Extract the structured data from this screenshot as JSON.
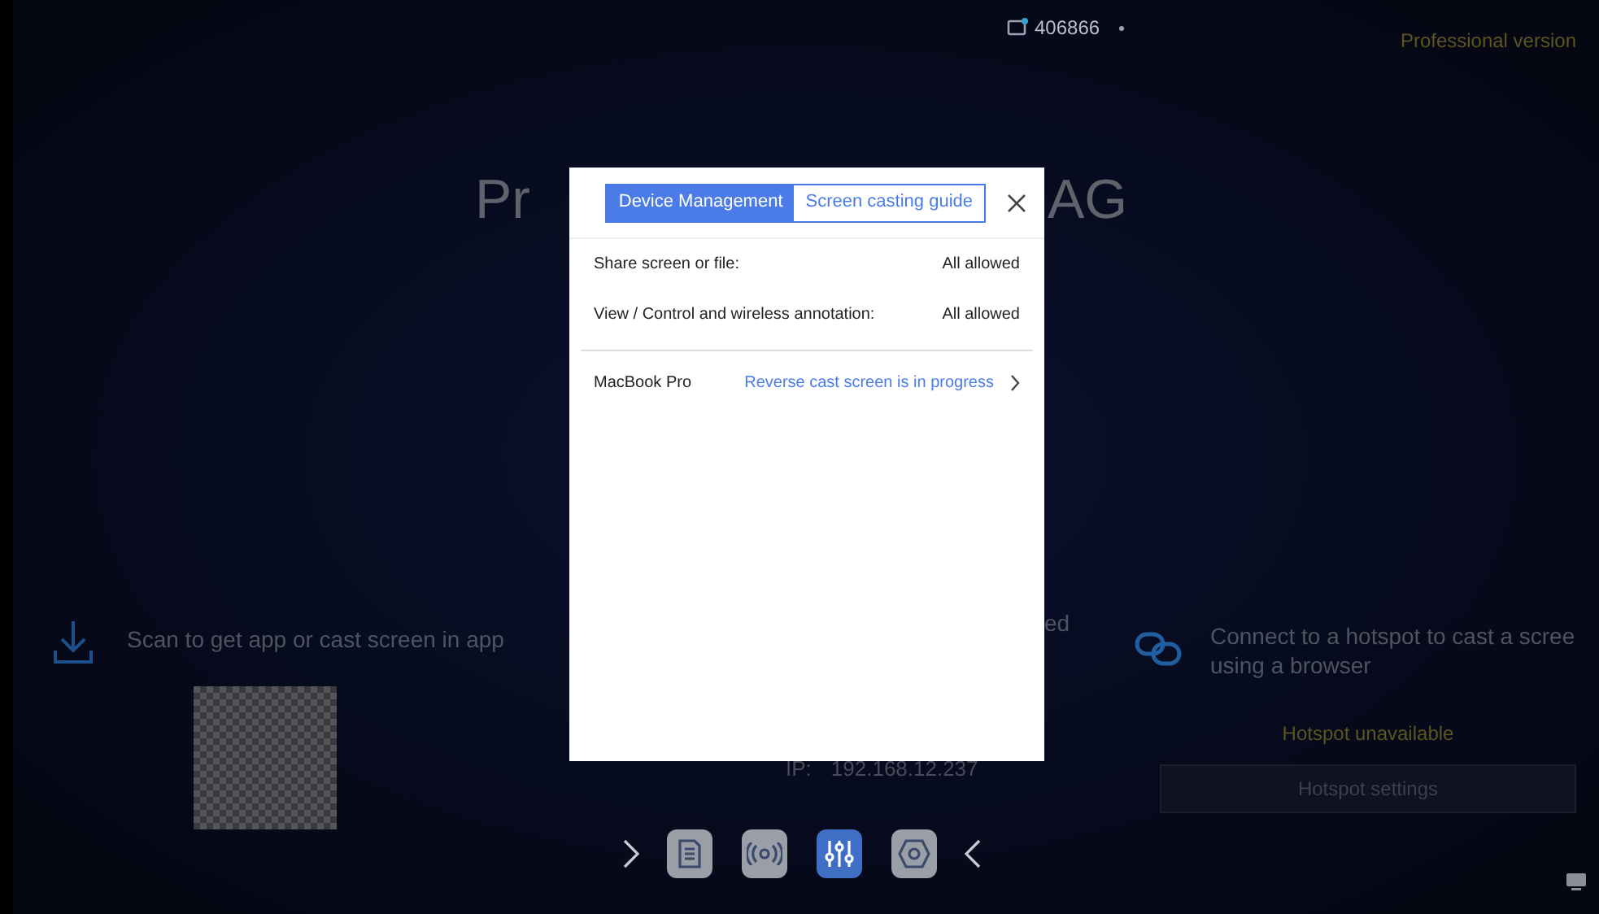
{
  "status_bar": {
    "code": "406866",
    "edition": "Professional version"
  },
  "background": {
    "title_left": "Pr",
    "title_right": "AG",
    "middle_fragment": "ed",
    "ip_label": "IP:",
    "ip": "192.168.12.237"
  },
  "scan_panel": {
    "text": "Scan to get app or cast screen in app"
  },
  "hotspot_panel": {
    "line_1": "Connect to a hotspot to cast a scree",
    "line_2": "using a browser",
    "status": "Hotspot unavailable",
    "button": "Hotspot settings"
  },
  "toolbar": {
    "items": [
      {
        "kind": "document",
        "selected": false
      },
      {
        "kind": "broadcast",
        "selected": false
      },
      {
        "kind": "mixer",
        "selected": true
      },
      {
        "kind": "hexagon",
        "selected": false
      }
    ]
  },
  "dialog": {
    "tabs": [
      {
        "label": "Device Management",
        "selected": true
      },
      {
        "label": "Screen casting guide",
        "selected": false
      }
    ],
    "settings": [
      {
        "label": "Share screen or file:",
        "value": "All allowed"
      },
      {
        "label": "View / Control and wireless annotation:",
        "value": "All allowed"
      }
    ],
    "devices": [
      {
        "name": "MacBook Pro",
        "status": "Reverse cast screen is in progress"
      }
    ]
  }
}
